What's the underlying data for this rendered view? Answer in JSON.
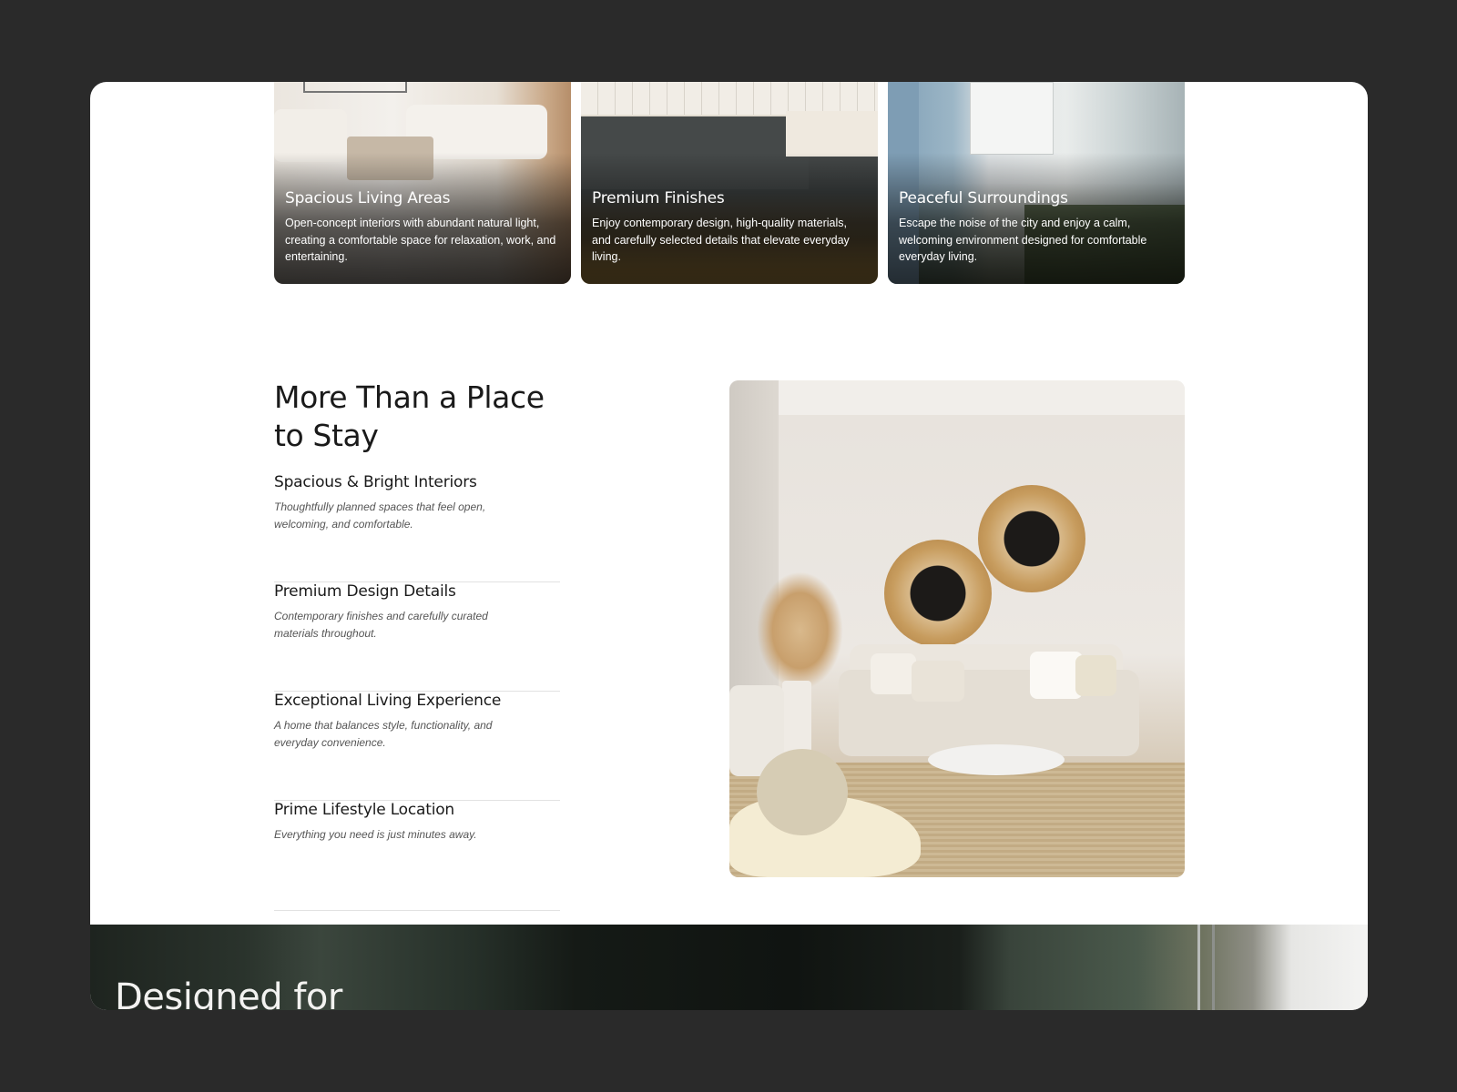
{
  "cards": [
    {
      "title": "Spacious Living Areas",
      "text": "Open-concept interiors with abundant natural light, creating a comfortable space for relaxation, work, and entertaining."
    },
    {
      "title": "Premium Finishes",
      "text": "Enjoy contemporary design, high-quality materials, and carefully selected details that elevate everyday living."
    },
    {
      "title": "Peaceful Surroundings",
      "text": "Escape the noise of the city and enjoy a calm, welcoming environment designed for comfortable everyday living."
    }
  ],
  "section": {
    "title": "More Than a Place to Stay",
    "features": [
      {
        "title": "Spacious & Bright Interiors",
        "text": "Thoughtfully planned spaces that feel open, welcoming, and comfortable."
      },
      {
        "title": "Premium Design Details",
        "text": "Contemporary finishes and carefully curated materials throughout."
      },
      {
        "title": "Exceptional Living Experience",
        "text": "A home that balances style, functionality, and everyday convenience."
      },
      {
        "title": "Prime Lifestyle Location",
        "text": "Everything you need is just minutes away."
      }
    ]
  },
  "band": {
    "heading": "Designed for"
  },
  "colors": {
    "background": "#2a2a2a",
    "page": "#ffffff",
    "text": "#1a1a1a",
    "muted": "#555555"
  }
}
